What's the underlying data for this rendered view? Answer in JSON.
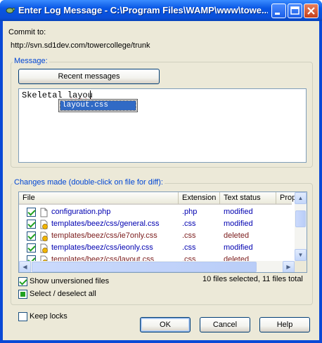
{
  "window": {
    "title": "Enter Log Message - C:\\Program Files\\WAMP\\www\\towe...",
    "controls": [
      "minimize-icon",
      "maximize-icon",
      "close-icon"
    ]
  },
  "commit": {
    "label": "Commit to:",
    "url": "http://svn.sd1dev.com/towercollege/trunk"
  },
  "message": {
    "group_title": "Message:",
    "recent_button": "Recent messages",
    "text_prefix": "Skeletal ",
    "text_misspelled": "layou",
    "autocomplete": [
      "layout.css"
    ]
  },
  "changes": {
    "group_title": "Changes made (double-click on file for diff):",
    "columns": [
      "File",
      "Extension",
      "Text status",
      "Prop"
    ],
    "rows": [
      {
        "file": "configuration.php",
        "ext": ".php",
        "status": "modified",
        "checked": true,
        "icon": "file-icon"
      },
      {
        "file": "templates/beez/css/general.css",
        "ext": ".css",
        "status": "modified",
        "checked": true,
        "icon": "css-file-icon"
      },
      {
        "file": "templates/beez/css/ie7only.css",
        "ext": ".css",
        "status": "deleted",
        "checked": true,
        "icon": "css-file-icon"
      },
      {
        "file": "templates/beez/css/ieonly.css",
        "ext": ".css",
        "status": "modified",
        "checked": true,
        "icon": "css-file-icon"
      },
      {
        "file": "templates/beez/css/layout.css",
        "ext": ".css",
        "status": "deleted",
        "checked": true,
        "icon": "css-file-icon"
      }
    ],
    "selection_summary": "10 files selected, 11 files total",
    "show_unversioned": {
      "label": "Show unversioned files",
      "checked": true
    },
    "select_all": {
      "label": "Select / deselect all",
      "state": "indeterminate"
    }
  },
  "keep_locks": {
    "label": "Keep locks",
    "checked": false
  },
  "buttons": {
    "ok": "OK",
    "cancel": "Cancel",
    "help": "Help"
  },
  "colors": {
    "titlebar": "#0a4fd8",
    "dialog_bg": "#ece9d8",
    "group_title": "#0046d5",
    "modified": "#0000b0",
    "deleted": "#7a1a1a",
    "selection": "#316ac5"
  }
}
